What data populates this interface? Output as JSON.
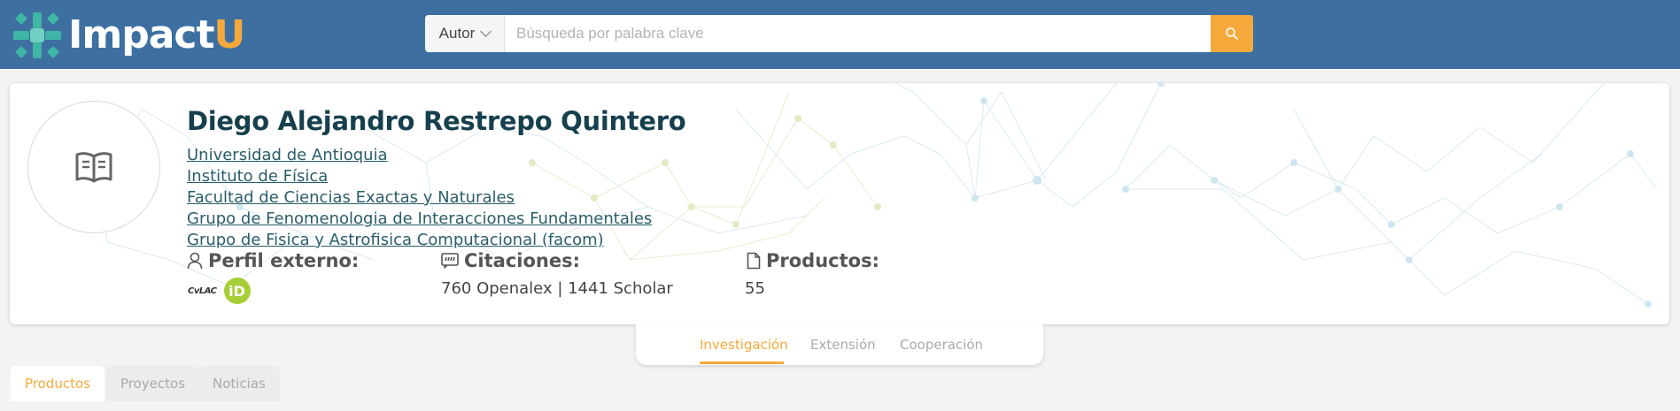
{
  "header": {
    "logo": {
      "main": "Impact",
      "accent": "U"
    },
    "search": {
      "select_value": "Autor",
      "placeholder": "Búsqueda por palabra clave"
    }
  },
  "profile": {
    "name": "Diego Alejandro Restrepo Quintero",
    "affiliations": [
      "Universidad de Antioquia",
      "Instituto de Física",
      "Facultad de Ciencias Exactas y Naturales",
      "Grupo de Fenomenologia de Interacciones Fundamentales",
      "Grupo de Fisica y Astrofisica Computacional (facom)"
    ],
    "stats": {
      "external_profile_label": "Perfil externo:",
      "citations_label": "Citaciones:",
      "citations_value": "760 Openalex | 1441 Scholar",
      "products_label": "Productos:",
      "products_value": "55"
    },
    "external_profiles": {
      "cvlac": "CvLAC",
      "orcid": "iD"
    }
  },
  "section_tabs": [
    "Investigación",
    "Extensión",
    "Cooperación"
  ],
  "content_tabs": [
    "Productos",
    "Proyectos",
    "Noticias"
  ],
  "colors": {
    "header": "#3d70a1",
    "accent": "#f6a93b",
    "name": "#17404e",
    "link": "#2a5d6a",
    "orcid": "#a6ce39",
    "logo_mark": "#3fb5a6"
  },
  "icons": {
    "search": "search-icon",
    "avatar": "open-book-icon",
    "external_profile": "user-icon",
    "citations": "quote-icon",
    "products": "document-icon"
  }
}
